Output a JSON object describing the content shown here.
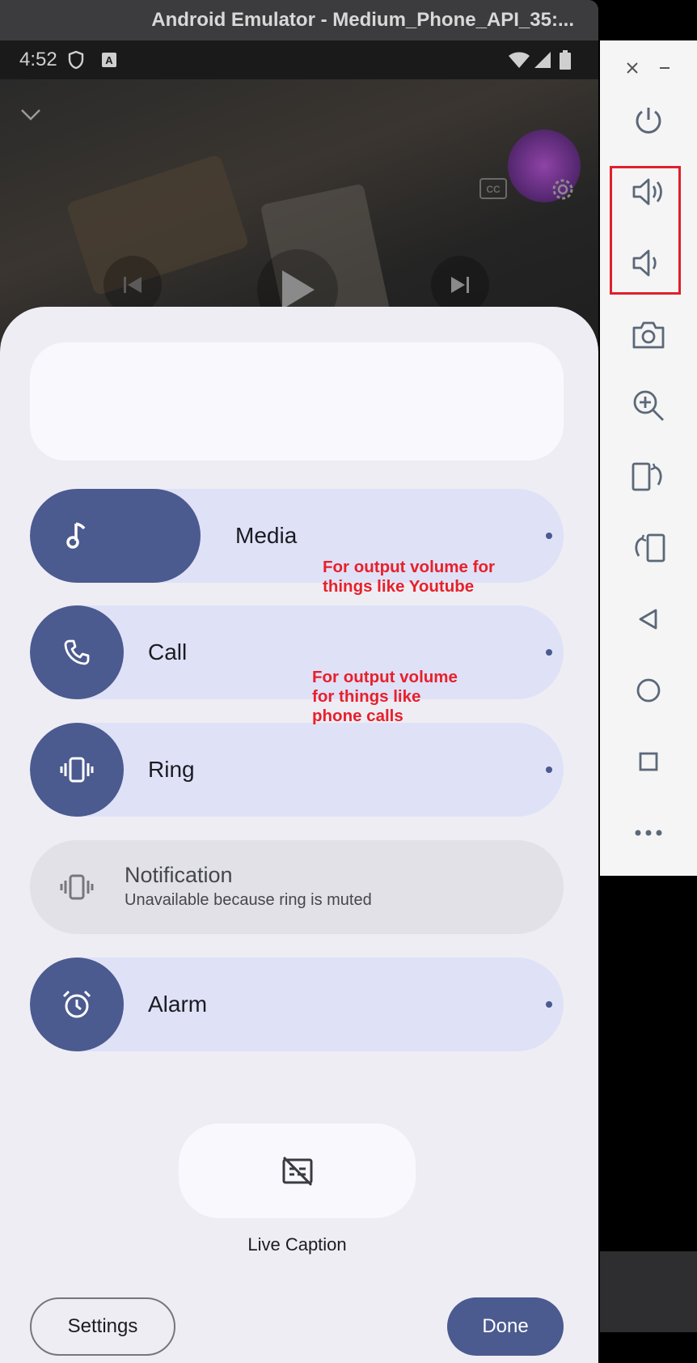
{
  "window": {
    "title": "Android Emulator - Medium_Phone_API_35:..."
  },
  "statusbar": {
    "time": "4:52"
  },
  "video_controls": {
    "collapse_icon": "chevron-down-icon",
    "cc_icon": "closed-captions-icon",
    "settings_icon": "gear-icon",
    "previous_icon": "skip-previous-icon",
    "play_icon": "play-icon",
    "next_icon": "skip-next-icon"
  },
  "volume_panel": {
    "sliders": [
      {
        "id": "media",
        "label": "Media",
        "level": 0.32,
        "icon": "music-note-icon"
      },
      {
        "id": "call",
        "label": "Call",
        "level": 0.0,
        "icon": "phone-icon"
      },
      {
        "id": "ring",
        "label": "Ring",
        "level": 0.0,
        "icon": "vibrate-icon"
      },
      {
        "id": "notification",
        "label": "Notification",
        "sublabel": "Unavailable because ring is muted",
        "icon": "vibrate-icon",
        "disabled": true
      },
      {
        "id": "alarm",
        "label": "Alarm",
        "level": 0.0,
        "icon": "alarm-clock-icon"
      }
    ],
    "live_caption": {
      "label": "Live Caption",
      "icon": "live-caption-off-icon"
    },
    "settings_button": "Settings",
    "done_button": "Done"
  },
  "annotations": {
    "media_note": "For output volume for things like Youtube",
    "call_note": "For output volume for things like phone calls"
  },
  "emulator_toolbar": {
    "items": [
      "close-icon",
      "minimize-icon",
      "power-icon",
      "volume-up-icon",
      "volume-down-icon",
      "camera-icon",
      "zoom-in-icon",
      "rotate-left-icon",
      "rotate-right-icon",
      "back-icon",
      "home-icon",
      "overview-icon",
      "more-icon"
    ]
  },
  "colors": {
    "accent": "#4b5a8f",
    "track": "#dfe1f7",
    "annotation": "#e8202a",
    "highlight": "#e0202a"
  }
}
